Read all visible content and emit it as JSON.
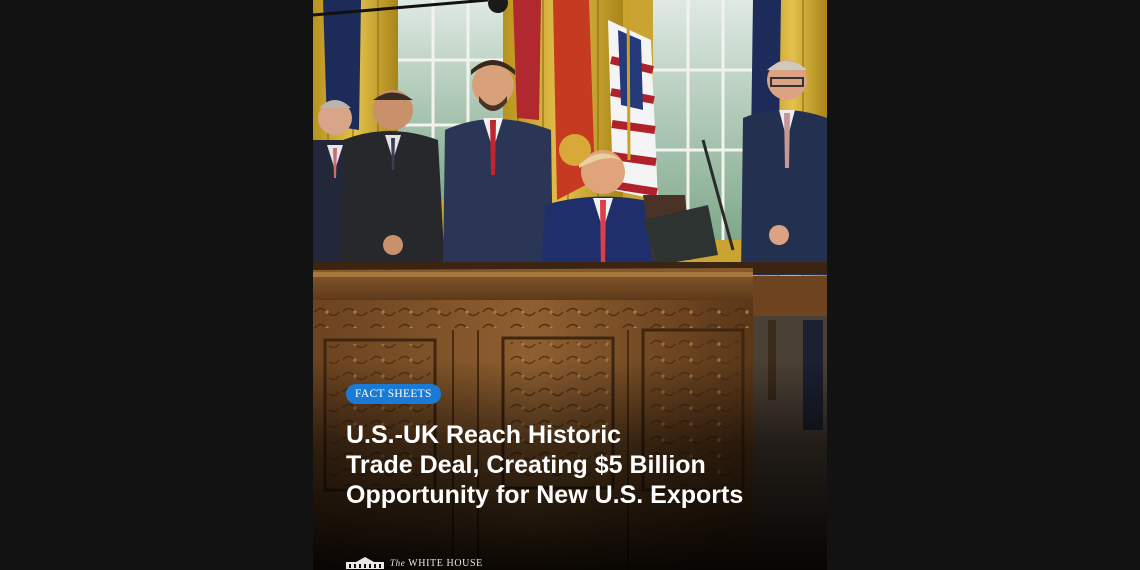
{
  "card": {
    "badge": "FACT SHEETS",
    "headline_lines": [
      "U.S.-UK Reach Historic",
      "Trade Deal, Creating $5 Billion",
      "Opportunity for New U.S. Exports"
    ],
    "footer": {
      "the": "The",
      "name": "WHITE HOUSE"
    }
  },
  "colors": {
    "badge": "#1a7bd6",
    "backdrop": "#111111",
    "desk": "#8b5a2b",
    "curtain": "#c9a227"
  }
}
